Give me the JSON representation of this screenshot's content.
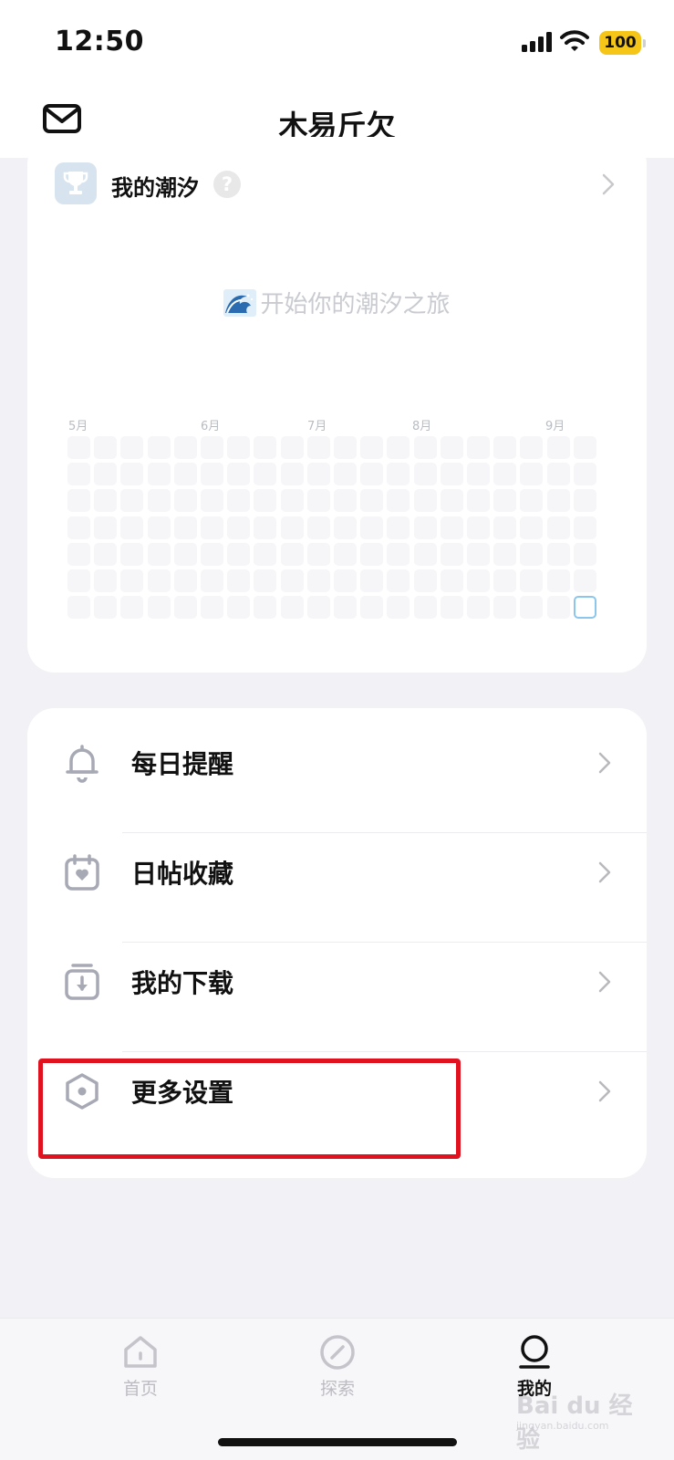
{
  "status_bar": {
    "time": "12:50",
    "battery": "100"
  },
  "header": {
    "title": "木易斤欠",
    "mail_icon": "mail-icon"
  },
  "tide": {
    "title": "我的潮汐",
    "help": "?",
    "empty_tip": "开始你的潮汐之旅",
    "months": [
      "5月",
      "6月",
      "7月",
      "8月",
      "9月"
    ],
    "grid": {
      "columns": 20,
      "rows": 7,
      "today": {
        "column": 19,
        "row": 6
      }
    }
  },
  "menu": {
    "items": [
      {
        "label": "每日提醒",
        "icon": "bell-icon"
      },
      {
        "label": "日帖收藏",
        "icon": "calendar-heart-icon"
      },
      {
        "label": "我的下载",
        "icon": "download-icon"
      },
      {
        "label": "更多设置",
        "icon": "settings-hexagon-icon"
      }
    ]
  },
  "tab_bar": {
    "tabs": [
      {
        "label": "首页",
        "icon": "home-icon",
        "active": false
      },
      {
        "label": "探索",
        "icon": "compass-icon",
        "active": false
      },
      {
        "label": "我的",
        "icon": "profile-icon",
        "active": true
      }
    ]
  },
  "watermark": {
    "main": "Bai du 经验",
    "sub": "jingyan.baidu.com"
  },
  "colors": {
    "highlight": "#e0121f",
    "battery": "#f5c518",
    "today_cell": "#8cc6ec"
  }
}
